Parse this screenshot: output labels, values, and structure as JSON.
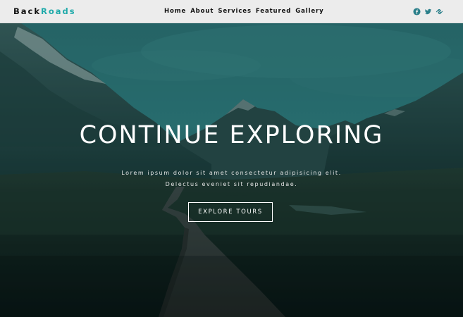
{
  "navbar": {
    "logo_part1": "Back",
    "logo_part2": "Roads",
    "links": [
      "Home",
      "About",
      "Services",
      "Featured",
      "Gallery"
    ],
    "social_icons": [
      "facebook-icon",
      "twitter-icon",
      "squarespace-icon"
    ]
  },
  "hero": {
    "title": "CONTINUE EXPLORING",
    "text_line1": "Lorem ipsum dolor sit amet consectetur adipisicing elit.",
    "text_line2": "Delectus eveniet sit repudiandae.",
    "button_label": "EXPLORE TOURS"
  },
  "colors": {
    "navbar_bg": "#ececec",
    "logo_dark": "#111111",
    "logo_accent": "#1faaaa",
    "social_icon": "#2a7f8a",
    "hero_overlay": "#0e3c3a",
    "text_light": "#ffffff"
  }
}
